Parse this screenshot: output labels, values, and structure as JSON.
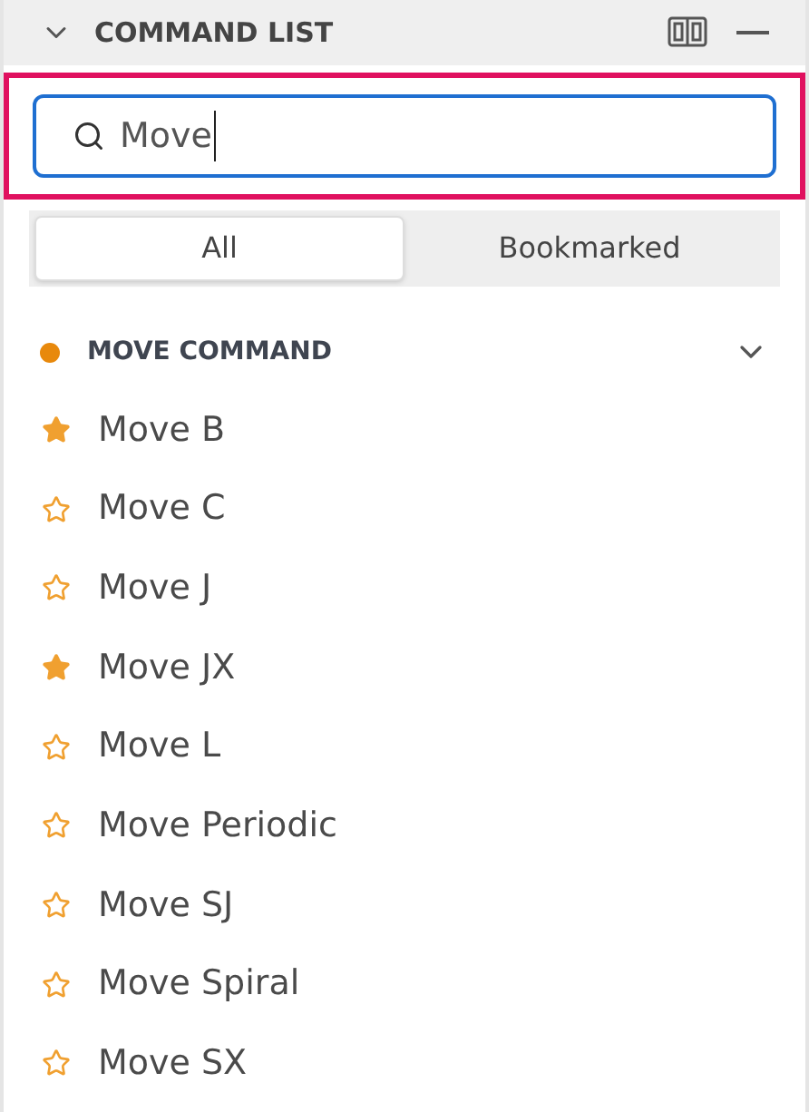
{
  "panel": {
    "title": "COMMAND LIST",
    "expanded": true
  },
  "search": {
    "value": "Move",
    "highlighted": true
  },
  "tabs": [
    {
      "label": "All",
      "selected": true
    },
    {
      "label": "Bookmarked",
      "selected": false
    }
  ],
  "group": {
    "title": "MOVE COMMAND",
    "color": "#e8890c",
    "expanded": true,
    "items": [
      {
        "label": "Move B",
        "bookmarked": true
      },
      {
        "label": "Move C",
        "bookmarked": false
      },
      {
        "label": "Move J",
        "bookmarked": false
      },
      {
        "label": "Move JX",
        "bookmarked": true
      },
      {
        "label": "Move L",
        "bookmarked": false
      },
      {
        "label": "Move Periodic",
        "bookmarked": false
      },
      {
        "label": "Move SJ",
        "bookmarked": false
      },
      {
        "label": "Move Spiral",
        "bookmarked": false
      },
      {
        "label": "Move SX",
        "bookmarked": false
      }
    ]
  }
}
